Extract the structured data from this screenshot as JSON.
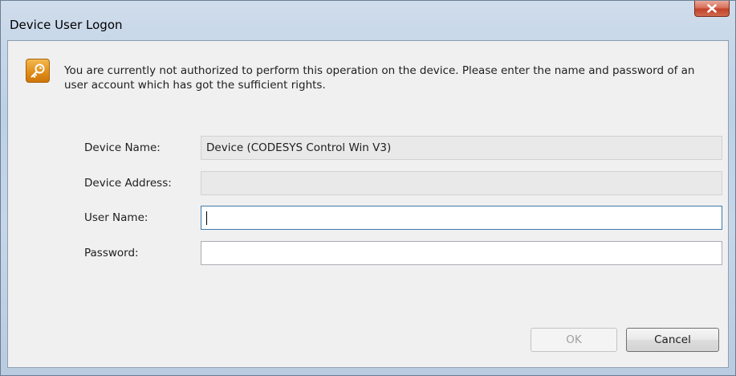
{
  "window": {
    "title": "Device User Logon"
  },
  "message": {
    "text": "You are currently not authorized to perform this operation on the device. Please enter the name and password of an user account which has got the sufficient rights.",
    "icon": "key-icon"
  },
  "form": {
    "device_name_label": "Device Name:",
    "device_name_value": "Device (CODESYS Control Win V3)",
    "device_address_label": "Device Address:",
    "device_address_value": "",
    "user_name_label": "User Name:",
    "user_name_value": "",
    "password_label": "Password:",
    "password_value": ""
  },
  "buttons": {
    "ok_label": "OK",
    "cancel_label": "Cancel"
  },
  "colors": {
    "icon_accent": "#e08f1c",
    "close_button": "#c2412a"
  }
}
